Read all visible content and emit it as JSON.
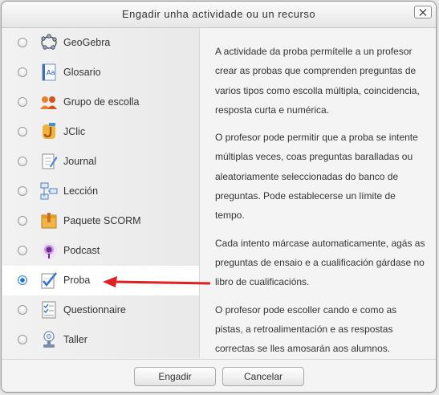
{
  "dialog": {
    "title": "Engadir unha actividade ou un recurso",
    "close_label": "×"
  },
  "options": [
    {
      "label": "GeoGebra",
      "icon": "geogebra-icon",
      "selected": false
    },
    {
      "label": "Glosario",
      "icon": "glossary-icon",
      "selected": false
    },
    {
      "label": "Grupo de escolla",
      "icon": "group-choice-icon",
      "selected": false
    },
    {
      "label": "JClic",
      "icon": "jclic-icon",
      "selected": false
    },
    {
      "label": "Journal",
      "icon": "journal-icon",
      "selected": false
    },
    {
      "label": "Lección",
      "icon": "lesson-icon",
      "selected": false
    },
    {
      "label": "Paquete SCORM",
      "icon": "scorm-package-icon",
      "selected": false
    },
    {
      "label": "Podcast",
      "icon": "podcast-icon",
      "selected": false
    },
    {
      "label": "Proba",
      "icon": "quiz-icon",
      "selected": true
    },
    {
      "label": "Questionnaire",
      "icon": "questionnaire-icon",
      "selected": false
    },
    {
      "label": "Taller",
      "icon": "workshop-icon",
      "selected": false
    }
  ],
  "description": {
    "paragraphs": [
      "A actividade da proba permítelle a un profesor crear as probas que comprenden preguntas de varios tipos como escolla múltipla, coincidencia, resposta curta e numérica.",
      "O profesor pode permitir que a proba se intente múltiplas veces, coas preguntas baralladas ou aleatoriamente seleccionadas do banco de preguntas. Pode establecerse un límite de tempo.",
      "Cada intento márcase automaticamente, agás as preguntas de ensaio e a cualificación gárdase no libro de cualificacións.",
      "O profesor pode escoller cando e como as pistas, a retroalimentación e as respostas correctas se lles amosarán aos alumnos."
    ]
  },
  "footer": {
    "add_label": "Engadir",
    "cancel_label": "Cancelar"
  },
  "colors": {
    "arrow": "#e02020",
    "radio_selected": "#1d6fd0"
  }
}
